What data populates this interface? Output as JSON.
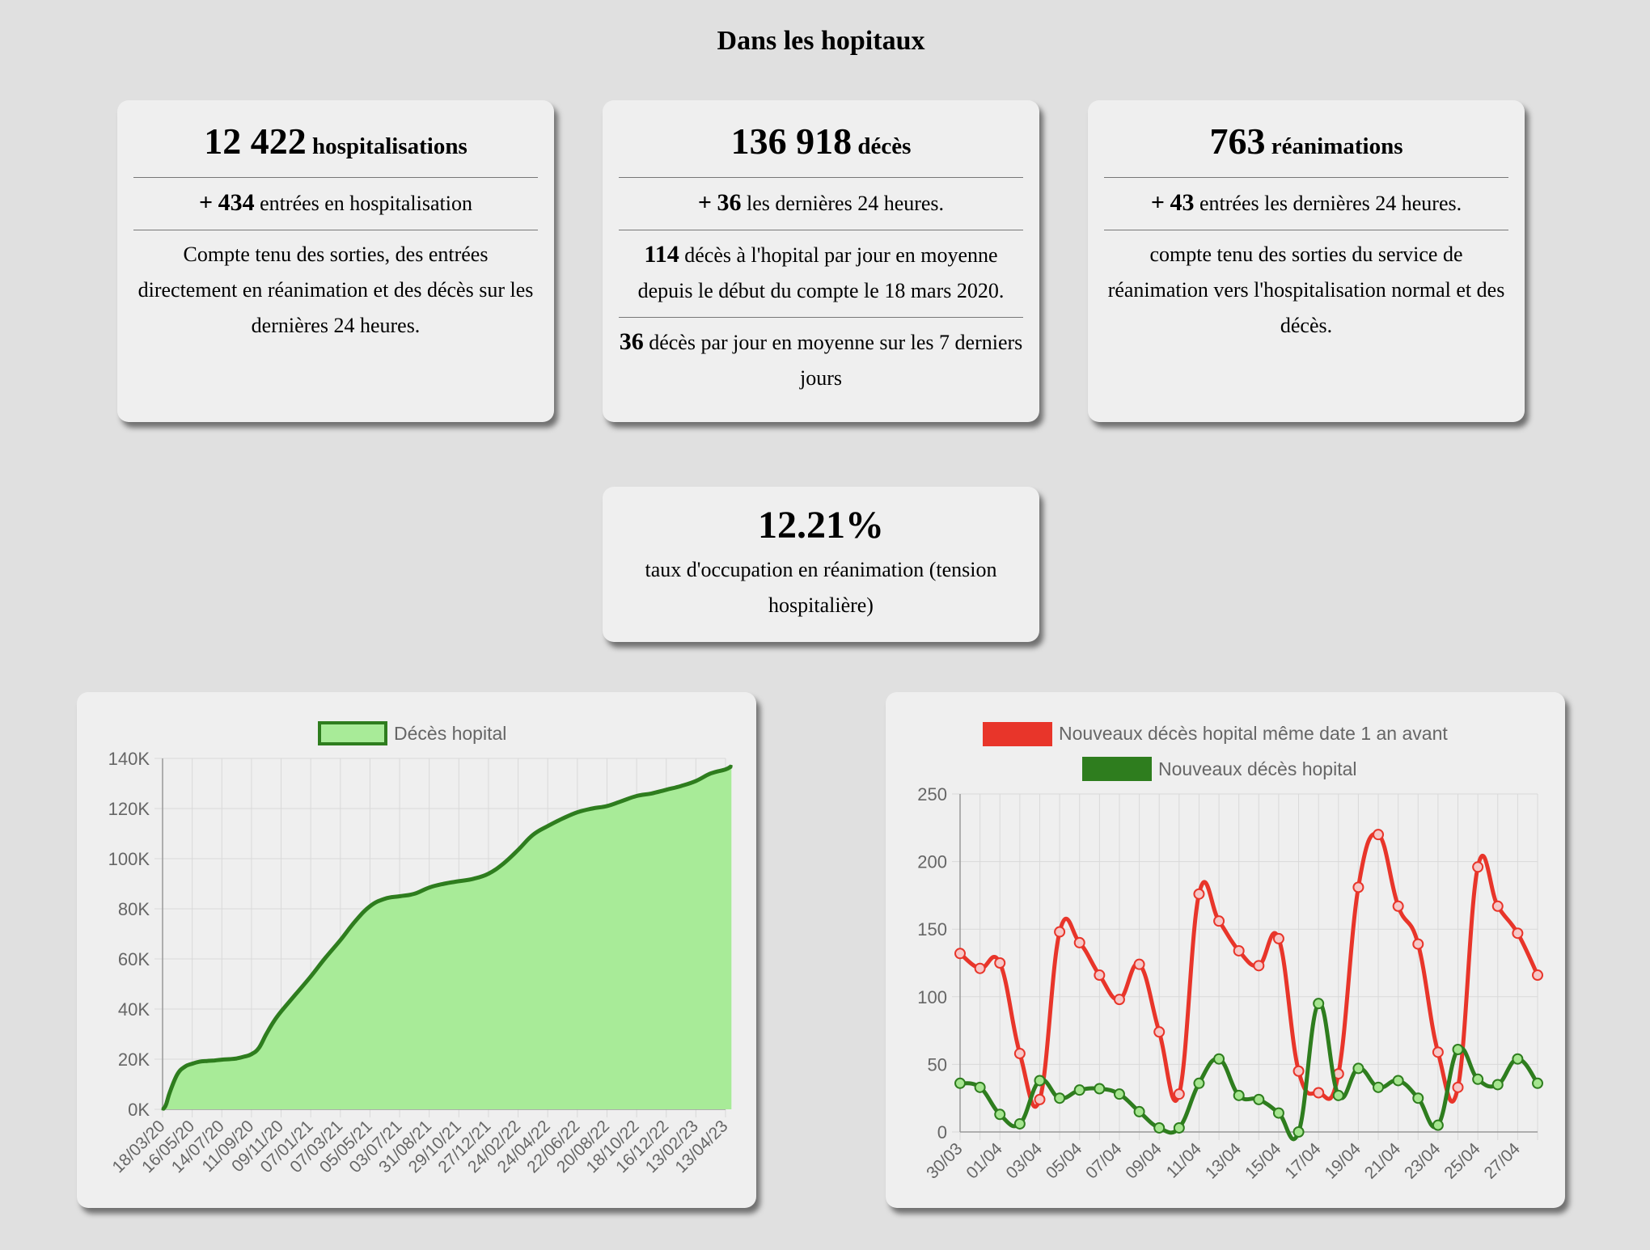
{
  "page_title": "Dans les hopitaux",
  "cards": [
    {
      "value": "12 422",
      "unit": "hospitalisations",
      "sub_prefix": "+",
      "sub_value": "434",
      "sub_text": "entrées en hospitalisation",
      "desc": "Compte tenu des sorties, des entrées directement en réanimation et des décès sur les dernières 24 heures."
    },
    {
      "value": "136 918",
      "unit": "décès",
      "sub_prefix": "+",
      "sub_value": "36",
      "sub_text": "les dernières 24 heures.",
      "desc1_value": "114",
      "desc1_text": "décès à l'hopital par jour en moyenne depuis le début du compte le 18 mars 2020.",
      "desc2_value": "36",
      "desc2_text": "décès par jour en moyenne sur les 7 derniers jours"
    },
    {
      "value": "763",
      "unit": "réanimations",
      "sub_prefix": "+",
      "sub_value": "43",
      "sub_text": "entrées les dernières 24 heures.",
      "desc": "compte tenu des sorties du service de réanimation vers l'hospitalisation normal et des décès."
    }
  ],
  "occupancy": {
    "value": "12.21%",
    "label": "taux d'occupation en réanimation (tension hospitalière)"
  },
  "colors": {
    "green_line": "#2e7d1e",
    "green_fill": "#a8eb98",
    "red_line": "#e8352a",
    "red_point": "#f6c8c8",
    "green_point": "#a5e58f",
    "grid": "#d9d9d9",
    "axis_text": "#666666"
  },
  "chart_data": [
    {
      "type": "area",
      "series": [
        {
          "name": "Décès hopital"
        }
      ],
      "legend": "top",
      "grid": true,
      "ylim": [
        0,
        140000
      ],
      "y_ticks": [
        "0K",
        "20K",
        "40K",
        "60K",
        "80K",
        "100K",
        "120K",
        "140K"
      ],
      "x_labels": [
        "18/03/20",
        "16/05/20",
        "14/07/20",
        "11/09/20",
        "09/11/20",
        "07/01/21",
        "07/03/21",
        "05/05/21",
        "03/07/21",
        "31/08/21",
        "29/10/21",
        "27/12/21",
        "24/02/22",
        "24/04/22",
        "22/06/22",
        "20/08/22",
        "18/10/22",
        "16/12/22",
        "13/02/23",
        "13/04/23"
      ],
      "x": [
        0,
        0.05,
        0.12,
        0.25,
        0.5,
        0.75,
        1,
        1.25,
        1.5,
        1.75,
        2,
        2.25,
        2.5,
        2.75,
        3,
        3.25,
        3.5,
        3.75,
        4,
        4.5,
        5,
        5.5,
        6,
        6.5,
        7,
        7.5,
        8,
        8.5,
        9,
        9.5,
        10,
        10.5,
        11,
        11.5,
        12,
        12.5,
        13,
        13.5,
        14,
        14.5,
        15,
        15.5,
        16,
        16.5,
        17,
        17.5,
        18,
        18.5,
        19,
        19.2
      ],
      "values": [
        0,
        500,
        2000,
        7000,
        14000,
        17000,
        18200,
        19000,
        19300,
        19500,
        19800,
        20000,
        20300,
        21000,
        22000,
        24500,
        30000,
        35000,
        39000,
        46000,
        53000,
        60500,
        67500,
        75000,
        81000,
        84000,
        85000,
        86000,
        88500,
        90000,
        91000,
        92000,
        94000,
        98000,
        103500,
        109500,
        113000,
        116000,
        118500,
        120000,
        121000,
        123000,
        125000,
        126000,
        127500,
        129000,
        131000,
        134000,
        135600,
        136918
      ]
    },
    {
      "type": "line",
      "legend": "top",
      "grid": true,
      "ylim": [
        0,
        250
      ],
      "y_ticks": [
        "0",
        "50",
        "100",
        "150",
        "200",
        "250"
      ],
      "x_labels": [
        "30/03",
        "01/04",
        "03/04",
        "05/04",
        "07/04",
        "09/04",
        "11/04",
        "13/04",
        "15/04",
        "17/04",
        "19/04",
        "21/04",
        "23/04",
        "25/04",
        "27/04"
      ],
      "series": [
        {
          "name": "Nouveaux décès hopital même date 1 an avant",
          "values": [
            132,
            121,
            125,
            58,
            24,
            148,
            140,
            116,
            98,
            124,
            74,
            28,
            176,
            156,
            134,
            123,
            143,
            45,
            29,
            43,
            181,
            220,
            167,
            139,
            59,
            33,
            196,
            167,
            147,
            116
          ]
        },
        {
          "name": "Nouveaux décès hopital",
          "values": [
            36,
            33,
            13,
            6,
            38,
            25,
            31,
            32,
            28,
            15,
            3,
            3,
            36,
            54,
            27,
            24,
            14,
            0,
            95,
            27,
            47,
            33,
            38,
            25,
            5,
            61,
            39,
            35,
            54,
            36
          ]
        }
      ]
    }
  ]
}
